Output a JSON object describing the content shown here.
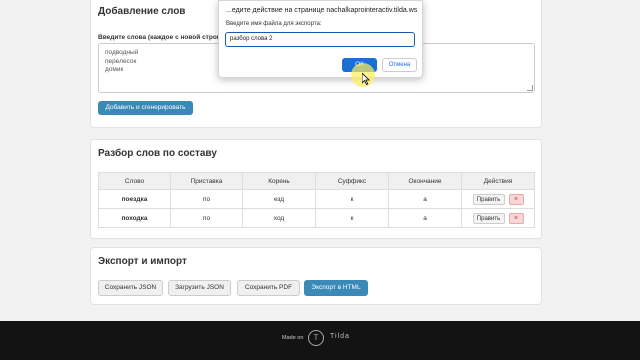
{
  "add_section": {
    "title": "Добавление слов",
    "words_label": "Введите слова (каждое с новой строки):",
    "words_value": "подводный\nперелесок\nдомик",
    "generate_button": "Добавить и сгенерировать"
  },
  "parse_section": {
    "title": "Разбор слов по составу",
    "columns": [
      "Слово",
      "Приставка",
      "Корень",
      "Суффикс",
      "Окончание",
      "Действия"
    ],
    "rows": [
      {
        "word": "поездка",
        "prefix": "по",
        "root": "езд",
        "suffix": "к",
        "ending": "а"
      },
      {
        "word": "походка",
        "prefix": "по",
        "root": "ход",
        "suffix": "к",
        "ending": "а"
      }
    ],
    "edit_label": "Править",
    "delete_label": "×"
  },
  "export_section": {
    "title": "Экспорт и импорт",
    "buttons": [
      "Сохранить JSON",
      "Загрузить JSON",
      "Сохранить PDF",
      "Экспорт в HTML"
    ]
  },
  "footer": {
    "made_on": "Made on",
    "logo_letter": "T",
    "brand": "Tilda"
  },
  "dialog": {
    "title": "...едите действие на странице nachalkaprointeractiv.tilda.ws",
    "prompt": "Введите имя файла для экспорта:",
    "input_value": "разбор слова 2",
    "ok_label": "ОК",
    "cancel_label": "Отмена"
  },
  "colors": {
    "primary_button": "#3a89b6",
    "dialog_ok": "#1a6fd6",
    "footer_bg": "#131313"
  }
}
